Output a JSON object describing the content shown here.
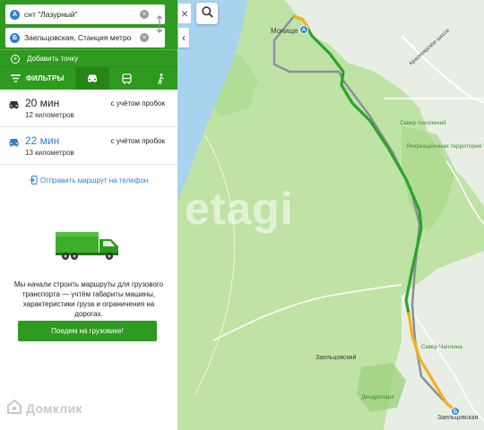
{
  "route_form": {
    "from": {
      "badge": "А",
      "value": "снт \"Лазурный\""
    },
    "to": {
      "badge": "Б",
      "value": "Заельцовская, Станция метро"
    },
    "add_point_label": "Добавить точку"
  },
  "mode_bar": {
    "filters_label": "ФИЛЬТРЫ",
    "modes": [
      {
        "name": "car",
        "active": true
      },
      {
        "name": "transit",
        "active": false
      },
      {
        "name": "walk",
        "active": false
      }
    ]
  },
  "routes": [
    {
      "time": "20 мин",
      "distance": "12 километров",
      "traffic": "с учётом пробок"
    },
    {
      "time": "22 мин",
      "distance": "13 километров",
      "traffic": "с учётом пробок"
    }
  ],
  "send_to_phone_label": "Отправить маршрут на телефон",
  "truck_promo": {
    "text": "Мы начали строить маршруты для грузового транспорта — учтём габариты машины, характеристики груза и ограничения на дорогах.",
    "button_label": "Поедем на грузовике!"
  },
  "brand": {
    "name": "Домклик"
  },
  "map": {
    "watermark": "etagi",
    "labels": {
      "start_place": "Мочище",
      "highway": "Красноярское шоссе",
      "park": "Сквер поколений",
      "territory": "Рекреационная территория \"Стрижи\"",
      "square": "Сквер Чаплина",
      "district": "Заельцовский",
      "dendro": "Дендропарк",
      "end_place": "Заельцовская"
    },
    "pins": {
      "start": "А",
      "end": "Б"
    },
    "colors": {
      "route_main": "#2aa52a",
      "route_traffic": "#f2b21b",
      "route_alt": "#8a8fa0",
      "river": "#a7d3ef",
      "forest": "#b9e09c",
      "urban": "#e9eee4"
    }
  },
  "colors": {
    "accent": "#2e9a1f",
    "link": "#2f7fd8"
  },
  "icons": {
    "close": "close-icon",
    "search": "search-icon",
    "collapse": "chevron-left-icon",
    "swap": "swap-icon",
    "clear": "clear-icon"
  }
}
